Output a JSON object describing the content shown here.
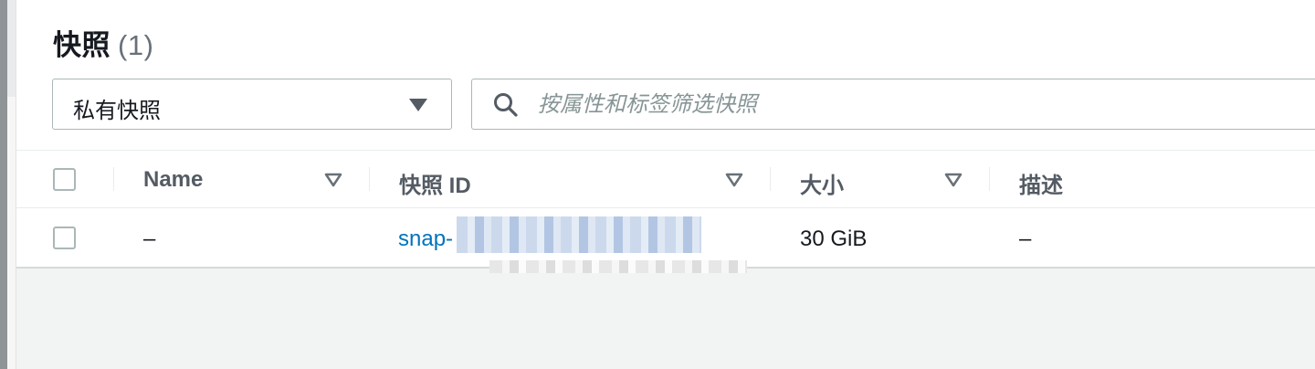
{
  "header": {
    "title": "快照",
    "count": "(1)"
  },
  "filter": {
    "selected": "私有快照"
  },
  "search": {
    "placeholder": "按属性和标签筛选快照"
  },
  "table": {
    "columns": [
      "Name",
      "快照 ID",
      "大小",
      "描述"
    ],
    "rows": [
      {
        "name": "–",
        "snapshot_id": "snap-",
        "size": "30 GiB",
        "description": "–"
      }
    ]
  },
  "colors": {
    "link": "#0073bb",
    "header_text": "#545b64",
    "border": "#aab7b8"
  },
  "icons": {
    "search": "search-icon",
    "dropdown": "caret-down-icon",
    "sort": "sort-down-icon"
  }
}
